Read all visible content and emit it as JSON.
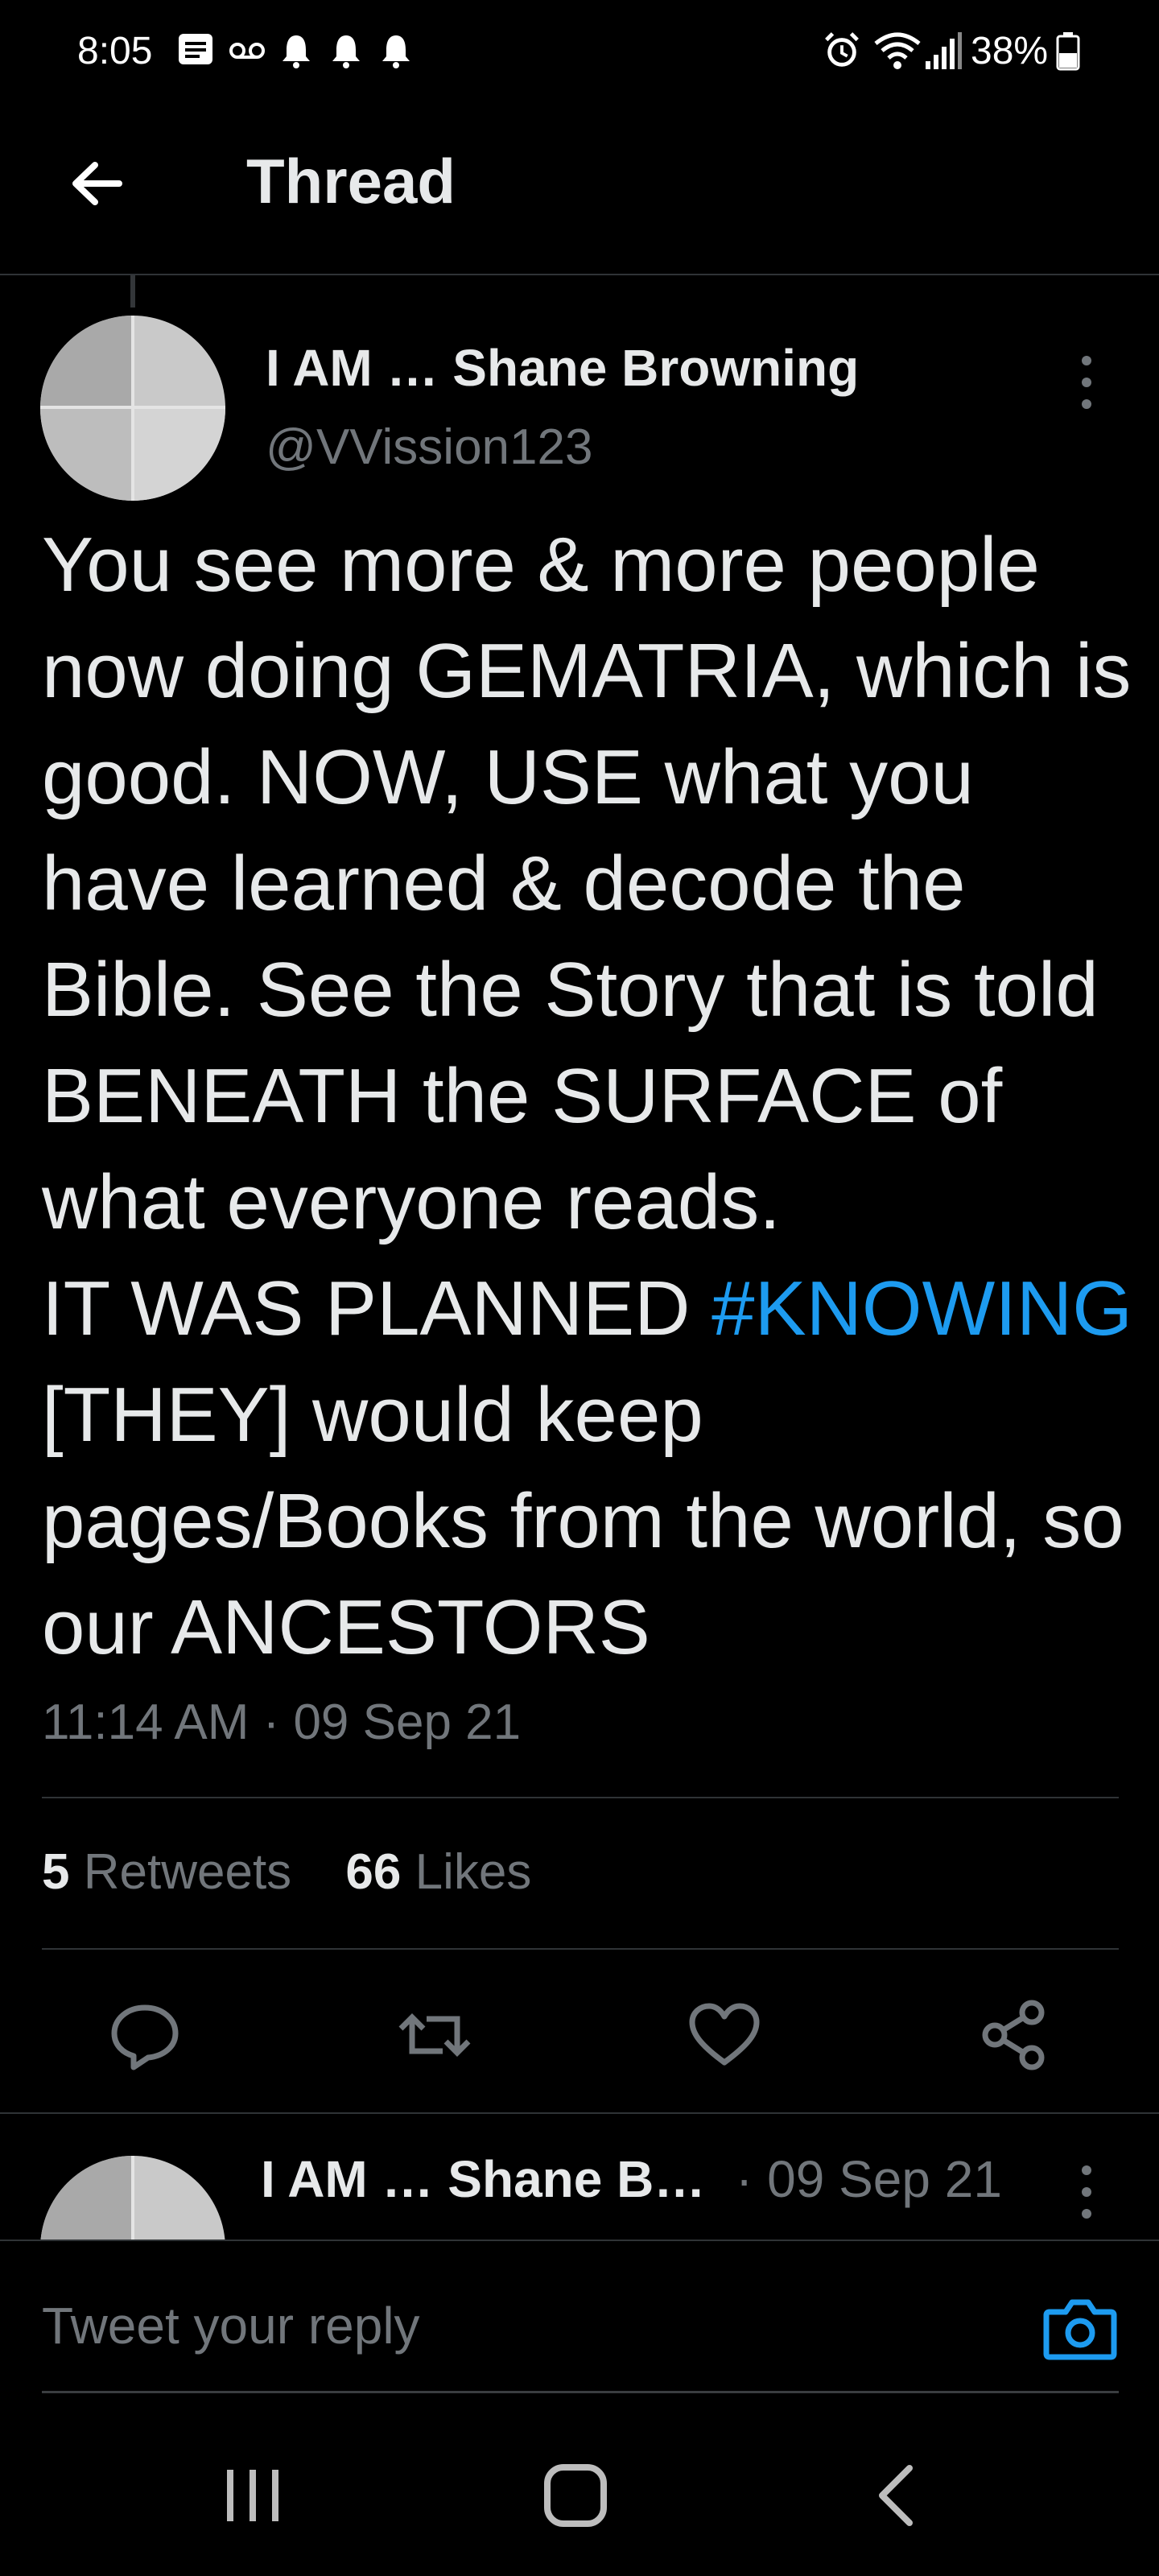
{
  "status_bar": {
    "time": "8:05",
    "battery": "38%",
    "left_icons": [
      "message-icon",
      "voicemail-icon",
      "bell-icon",
      "bell-icon",
      "bell-icon"
    ],
    "right_icons": [
      "alarm-icon",
      "wifi-icon",
      "signal-icon",
      "battery-icon"
    ]
  },
  "header": {
    "title": "Thread"
  },
  "tweet": {
    "name": "I AM … Shane Browning",
    "handle": "@VVission123",
    "text_before": "You see more & more people now doing GEMATRIA, which is good. NOW, USE what you have learned & decode the Bible. See the Story that is told BENEATH the SURFACE of what everyone reads.\nIT WAS PLANNED ",
    "hashtag": "#KNOWING",
    "text_after": " [THEY] would keep pages/Books from the world, so our ANCESTORS",
    "timestamp": "11:14 AM · 09 Sep 21",
    "retweets_count": "5",
    "retweets_label": "Retweets",
    "likes_count": "66",
    "likes_label": "Likes"
  },
  "reply_preview": {
    "name": "I AM … Shane B…",
    "date": "· 09 Sep 21"
  },
  "reply_bar": {
    "placeholder": "Tweet your reply"
  },
  "colors": {
    "accent": "#1d9bf0",
    "background": "#000000",
    "text": "#e7e9ea",
    "muted": "#71767b"
  }
}
